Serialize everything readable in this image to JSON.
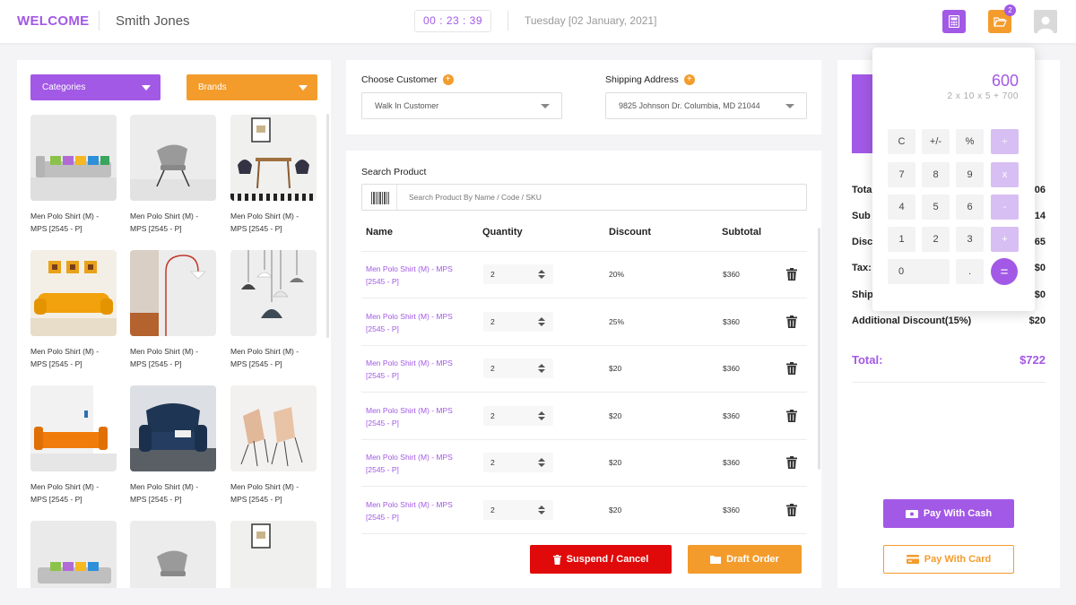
{
  "header": {
    "welcome": "WELCOME",
    "username": "Smith Jones",
    "timer": "00 : 23 : 39",
    "date": "Tuesday [02 January, 2021]",
    "folder_badge": "2",
    "accent": "#a259e6",
    "secondary": "#f39c2c"
  },
  "filters": {
    "categories": "Categories",
    "brands": "Brands"
  },
  "products": [
    {
      "name": "Men Polo Shirt (M) - MPS [2545 - P]",
      "image": "grey-sofa"
    },
    {
      "name": "Men Polo Shirt (M) - MPS [2545 - P]",
      "image": "grey-chair"
    },
    {
      "name": "Men Polo Shirt (M) - MPS [2545 - P]",
      "image": "dining-set"
    },
    {
      "name": "Men Polo Shirt (M) - MPS [2545 - P]",
      "image": "yellow-sofa"
    },
    {
      "name": "Men Polo Shirt (M) - MPS [2545 - P]",
      "image": "floor-lamp"
    },
    {
      "name": "Men Polo Shirt (M) - MPS [2545 - P]",
      "image": "pendant-lamps"
    },
    {
      "name": "Men Polo Shirt (M) - MPS [2545 - P]",
      "image": "orange-sofa"
    },
    {
      "name": "Men Polo Shirt (M) - MPS [2545 - P]",
      "image": "blue-armchair"
    },
    {
      "name": "Men Polo Shirt (M) - MPS [2545 - P]",
      "image": "wood-chairs"
    },
    {
      "name": "",
      "image": "grey-sofa"
    },
    {
      "name": "",
      "image": "grey-chair"
    },
    {
      "name": "",
      "image": "dining-set"
    }
  ],
  "customer": {
    "label": "Choose Customer",
    "value": "Walk In Customer",
    "shipping_label": "Shipping Address",
    "shipping_value": "9825 Johnson Dr. Columbia, MD 21044"
  },
  "search": {
    "label": "Search Product",
    "placeholder": "Search Product By Name / Code / SKU"
  },
  "table": {
    "headers": [
      "Name",
      "Quantity",
      "Discount",
      "Subtotal"
    ],
    "rows": [
      {
        "name": "Men Polo Shirt (M) - MPS [2545 - P]",
        "qty": "2",
        "discount": "20%",
        "subtotal": "$360"
      },
      {
        "name": "Men Polo Shirt (M) - MPS [2545 - P]",
        "qty": "2",
        "discount": "25%",
        "subtotal": "$360"
      },
      {
        "name": "Men Polo Shirt (M) - MPS [2545 - P]",
        "qty": "2",
        "discount": "$20",
        "subtotal": "$360"
      },
      {
        "name": "Men Polo Shirt (M) - MPS [2545 - P]",
        "qty": "2",
        "discount": "$20",
        "subtotal": "$360"
      },
      {
        "name": "Men Polo Shirt (M) - MPS [2545 - P]",
        "qty": "2",
        "discount": "$20",
        "subtotal": "$360"
      },
      {
        "name": "Men Polo Shirt (M) - MPS [2545 - P]",
        "qty": "2",
        "discount": "$20",
        "subtotal": "$360"
      }
    ]
  },
  "actions": {
    "suspend": "Suspend / Cancel",
    "draft": "Draft Order"
  },
  "summary": {
    "rows": [
      {
        "label": "Tota",
        "value": "06"
      },
      {
        "label": "Sub",
        "value": "14"
      },
      {
        "label": "Disc",
        "value": "65"
      },
      {
        "label": "Tax:",
        "value": "$0"
      },
      {
        "label": "Ship",
        "value": "$0"
      },
      {
        "label": "Additional Discount(15%)",
        "value": "$20"
      }
    ],
    "total_label": "Total:",
    "total_value": "$722",
    "pay_cash": "Pay With Cash",
    "pay_card": "Pay With Card"
  },
  "calculator": {
    "result": "600",
    "expression": "2 x 10 x 5 + 700",
    "keys": [
      [
        "C",
        "+/-",
        "%",
        "÷"
      ],
      [
        "7",
        "8",
        "9",
        "x"
      ],
      [
        "4",
        "5",
        "6",
        "-"
      ],
      [
        "1",
        "2",
        "3",
        "+"
      ],
      [
        "0",
        ".",
        "="
      ]
    ]
  }
}
